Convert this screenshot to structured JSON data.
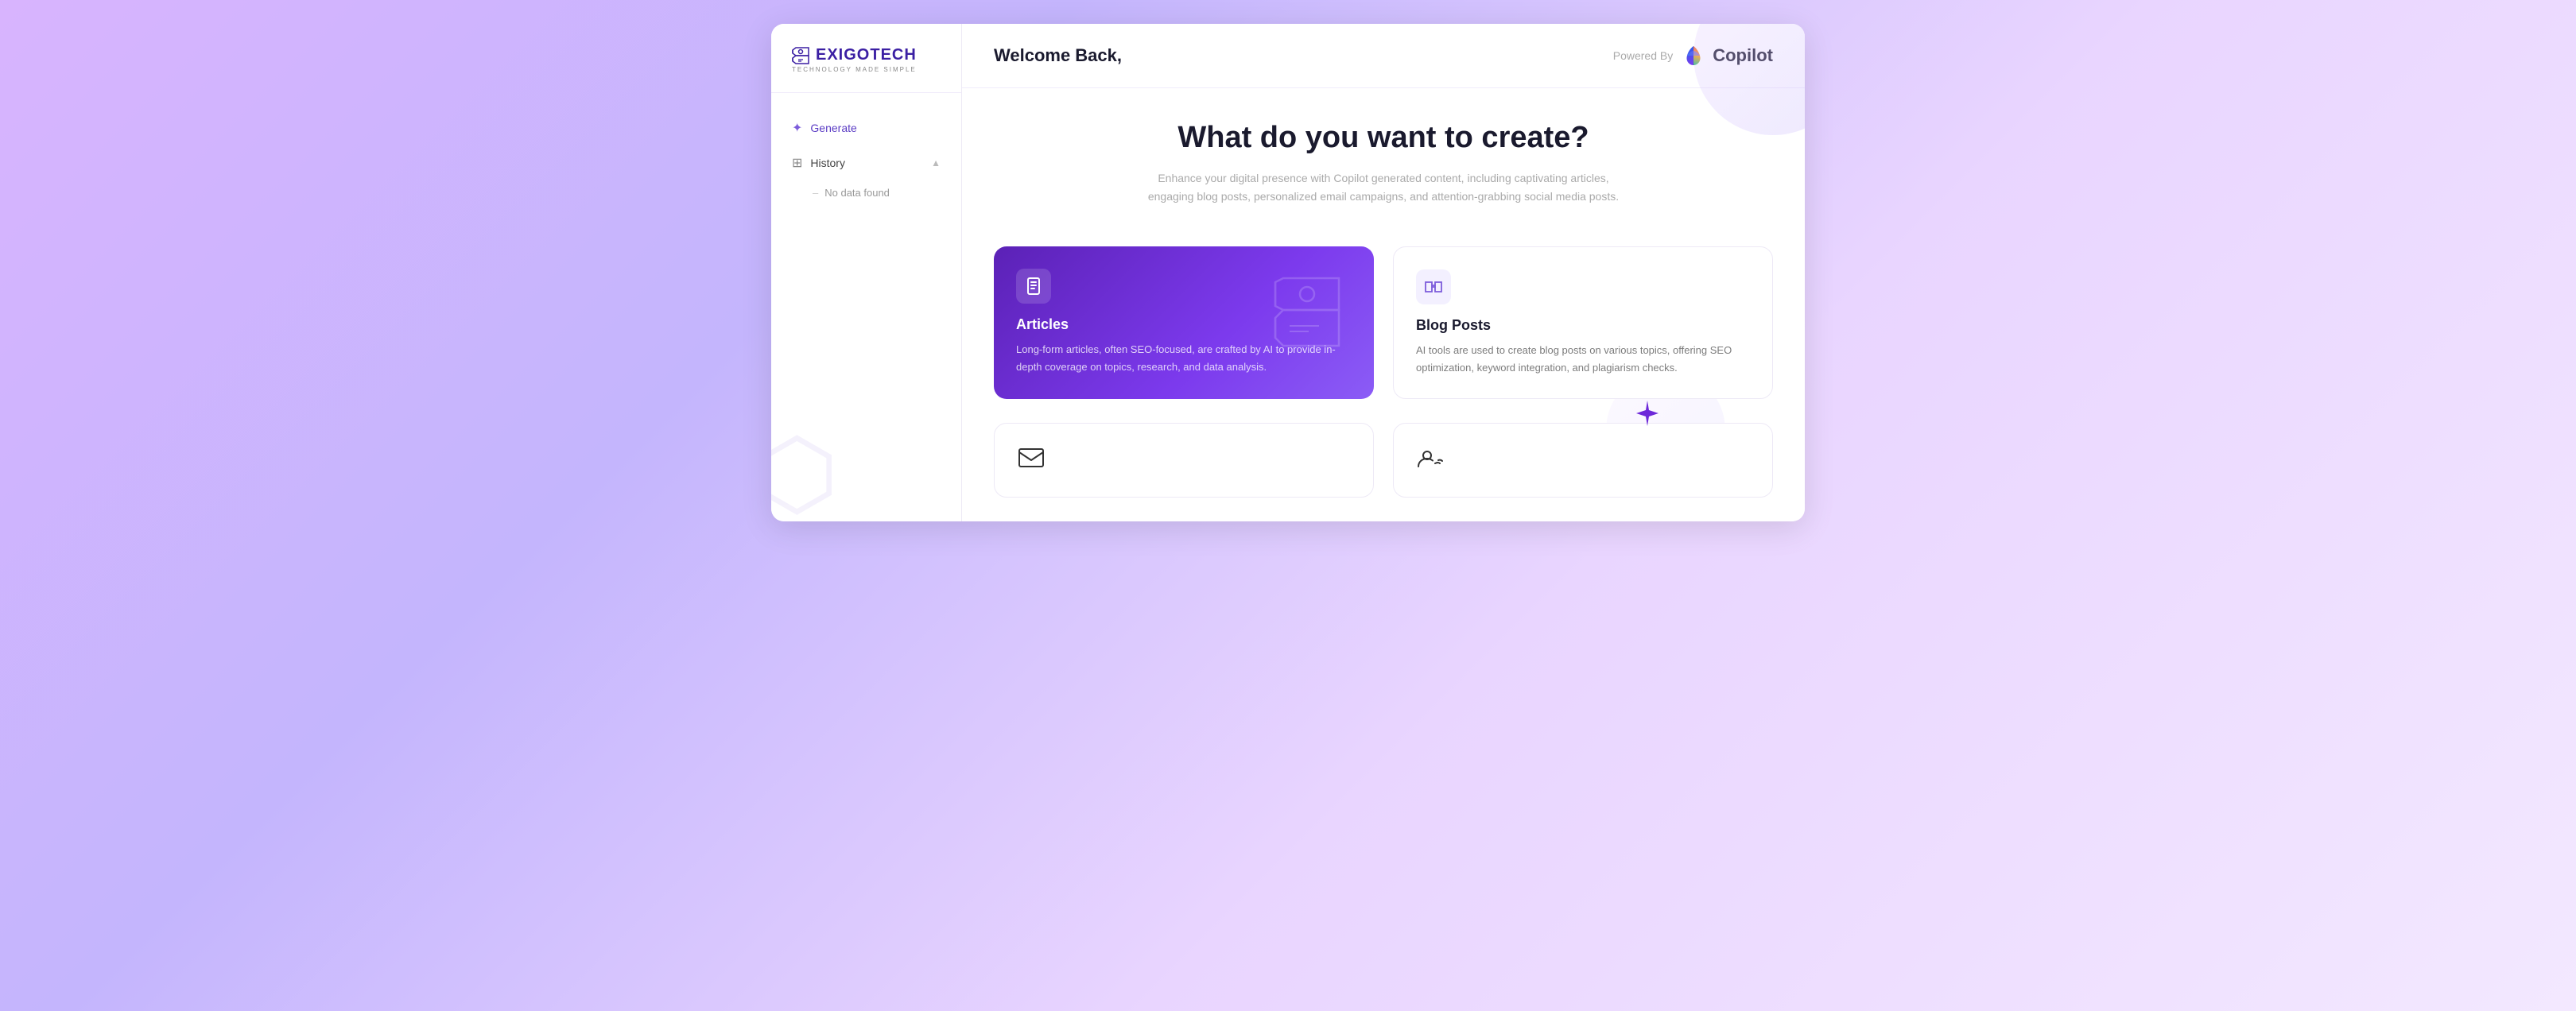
{
  "brand": {
    "name": "EXIGOTECH",
    "subtitle": "TECHNOLOGY MADE SIMPLE"
  },
  "header": {
    "welcome": "Welcome Back,",
    "powered_by_label": "Powered By",
    "copilot_name": "Copilot"
  },
  "sidebar": {
    "generate_label": "Generate",
    "history_label": "History",
    "no_data_label": "No data found"
  },
  "hero": {
    "title": "What do you want to create?",
    "subtitle": "Enhance your digital presence with Copilot generated content, including captivating articles, engaging blog posts, personalized email campaigns, and attention-grabbing social media posts."
  },
  "cards": [
    {
      "id": "articles",
      "title": "Articles",
      "desc": "Long-form articles, often SEO-focused, are crafted by AI to provide in-depth coverage on topics, research, and data analysis.",
      "icon": "📄",
      "type": "featured"
    },
    {
      "id": "blog-posts",
      "title": "Blog Posts",
      "desc": "AI tools are used to create blog posts on various topics, offering SEO optimization, keyword integration, and plagiarism checks.",
      "icon": "📖",
      "type": "plain"
    }
  ],
  "bottom_cards": [
    {
      "id": "email",
      "icon": "✉",
      "partial": true
    },
    {
      "id": "social",
      "icon": "👤",
      "partial": true
    }
  ]
}
